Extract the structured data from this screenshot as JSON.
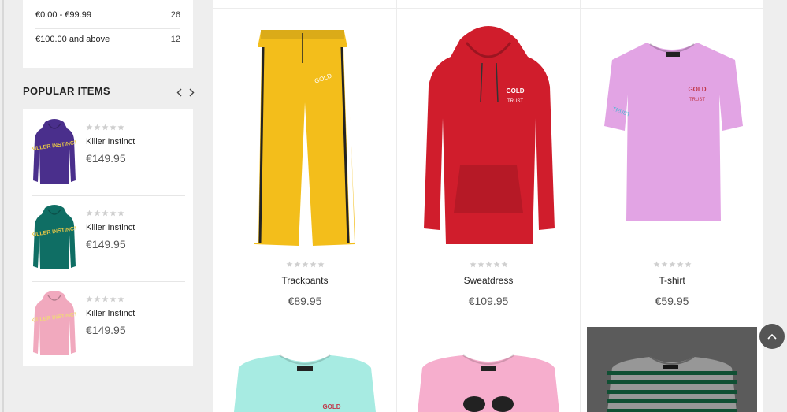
{
  "price_filter": [
    {
      "label": "€0.00 - €99.99",
      "count": "26"
    },
    {
      "label": "€100.00 and above",
      "count": "12"
    }
  ],
  "popular": {
    "title": "POPULAR ITEMS",
    "items": [
      {
        "name": "Killer Instinct",
        "price": "€149.95",
        "color": "#4a2f8c",
        "text_color": "#e9c846"
      },
      {
        "name": "Killer Instinct",
        "price": "€149.95",
        "color": "#0f6e64",
        "text_color": "#e9c846"
      },
      {
        "name": "Killer Instinct",
        "price": "€149.95",
        "color": "#f1a9be",
        "text_color": "#f0d77a"
      }
    ]
  },
  "products": [
    {
      "name": "Trackpants",
      "price": "€89.95",
      "color": "#f3be1b"
    },
    {
      "name": "Sweatdress",
      "price": "€109.95",
      "color": "#d01d2c"
    },
    {
      "name": "T-shirt",
      "price": "€59.95",
      "color": "#e2a4e4"
    }
  ],
  "row2_colors": [
    "#a7ebe2",
    "#f6aecd",
    "#1a7a4f"
  ],
  "star_color": "#cfcfcf"
}
